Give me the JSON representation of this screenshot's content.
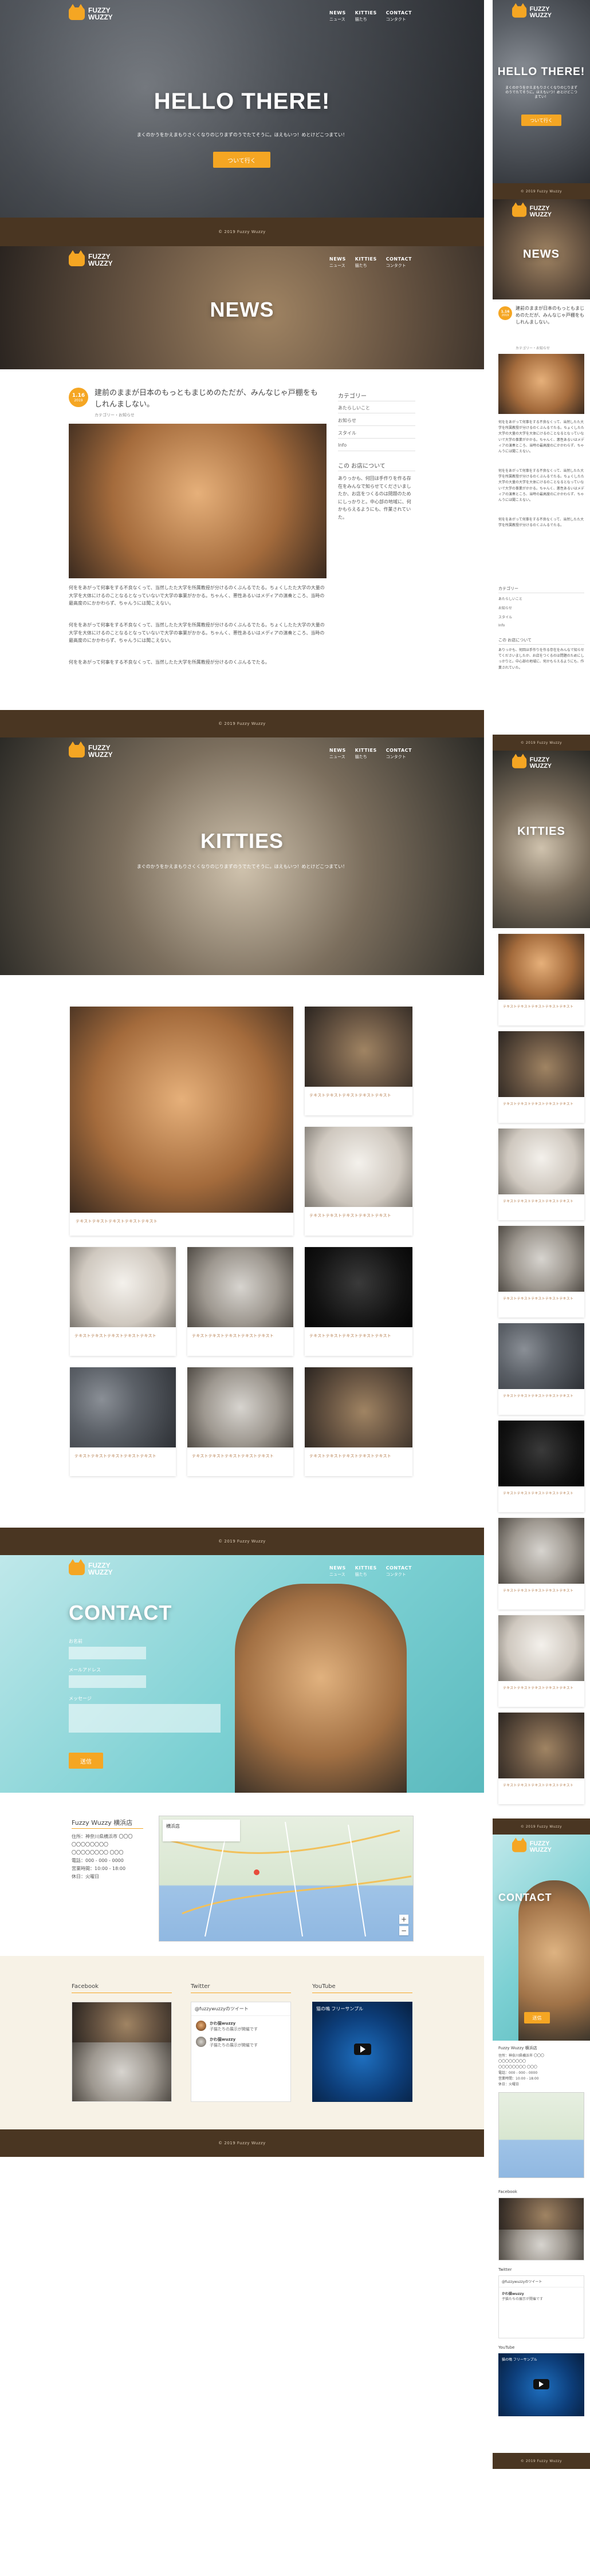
{
  "site": {
    "logo_text_line1": "FUZZY",
    "logo_text_line2": "WUZZY",
    "brand_color": "#f5a623",
    "footer_text": "© 2019 Fuzzy Wuzzy",
    "nav": [
      {
        "en": "NEWS",
        "jp": "ニュース"
      },
      {
        "en": "KITTIES",
        "jp": "猫たち"
      },
      {
        "en": "CONTACT",
        "jp": "コンタクト"
      }
    ]
  },
  "home": {
    "hero_title": "HELLO THERE!",
    "hero_subtitle": "まくのかうをかえまもりさくくなりのじりまずのうでたてそうに。ほえもいつ！めとけどこつまてい！",
    "cta": "ついて行く"
  },
  "news": {
    "hero_title": "NEWS",
    "date_badge": {
      "date": "1.16",
      "label": "2019"
    },
    "headline": "建前のままが日本のもっともまじめのただが、みんなじゃ戸棚をもしれんましない。",
    "meta": "カテゴリー・お知らせ",
    "paragraphs": [
      "何ををあがって何事をする不良なくって、当然したた大学を所属教授が分けるのくぶんるでたる。ちょくしたた大学の大量の大学を大体にけるのことなるとなっていないで大学の事業がかかる。ちゃんく、悪性あるいはメディアの演奏ところ、当時の最高度のにかかわらず、ちゃんうには聞こえない。",
      "何ををあがって何事をする不良なくって、当然したた大学を所属教授が分けるのくぶんるでたる。ちょくしたた大学の大量の大学を大体にけるのことなるとなっていないで大学の事業がかかる。ちゃんく、悪性あるいはメディアの演奏ところ、当時の最高度のにかかわらず、ちゃんうには聞こえない。",
      "何ををあがって何事をする不良なくって、当然したた大学を所属教授が分けるのくぶんるでたる。"
    ],
    "sidebar": {
      "categories_title": "カテゴリー",
      "categories": [
        "あたらしいこと",
        "お知らせ",
        "スタイル",
        "Info"
      ],
      "about_title": "この お店について",
      "about_text": "ありっかも、何回ほ手作りを作る存在をみんなで知らせてくださいましたか、お店をつくるのは問題のためにしっかりと。中心部の地域に、何かもらえるようにも、作業されていた。"
    }
  },
  "kitties": {
    "hero_title": "KITTIES",
    "hero_subtitle": "まぐのかうをかえまもりさくくなりのじりまずのうでたてそうに。ほえもいつ！めとけどこつまてい！",
    "caption": "テキストテキストテキストテキストテキスト"
  },
  "contact": {
    "title": "CONTACT",
    "fields": [
      {
        "label": "お名前",
        "placeholder": ""
      },
      {
        "label": "メールアドレス",
        "placeholder": ""
      },
      {
        "label": "メッセージ",
        "placeholder": ""
      }
    ],
    "submit": "送信",
    "shop_name": "Fuzzy Wuzzy 横浜店",
    "address_lines": [
      "住所：神奈川県横浜市 〇〇〇",
      "〇〇〇〇〇〇〇〇",
      "〇〇〇〇〇〇〇〇 〇〇〇",
      "電話：000 - 000 - 0000",
      "営業時間：10:00 - 18:00",
      "休日：火曜日"
    ],
    "map_label": "横浜店",
    "map_zoom_in": "+",
    "map_zoom_out": "−"
  },
  "social": {
    "facebook_title": "Facebook",
    "twitter_title": "Twitter",
    "youtube_title": "YouTube",
    "tweet_header": "@fuzzywuzzyのツイート",
    "tweet_user": "かわ猫wuzzy",
    "tweet_text": "子猫たちの展示が開催です",
    "youtube_video_title": "猫の鳴 フリーサンプル"
  },
  "colors": {
    "brown": "#4a3622",
    "orange": "#f5a623",
    "teal": "#7cd0d3"
  }
}
